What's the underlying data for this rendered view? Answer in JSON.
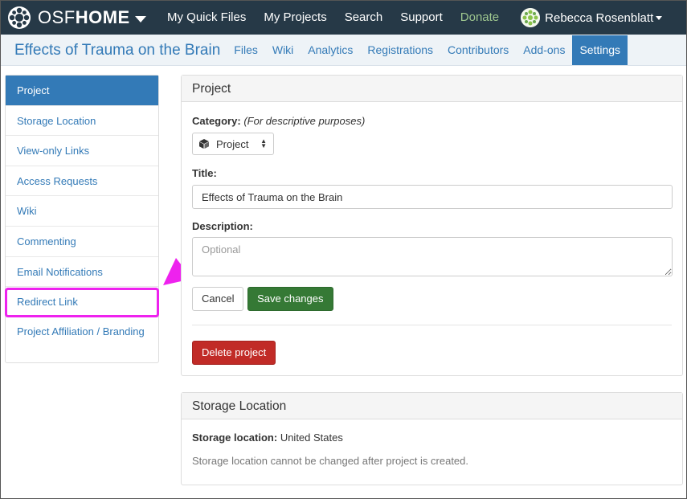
{
  "topnav": {
    "brand_osf": "OSF",
    "brand_home": "HOME",
    "links": [
      "My Quick Files",
      "My Projects",
      "Search",
      "Support"
    ],
    "donate": "Donate",
    "user_name": "Rebecca Rosenblatt"
  },
  "subnav": {
    "project_title": "Effects of Trauma on the Brain",
    "tabs": [
      "Files",
      "Wiki",
      "Analytics",
      "Registrations",
      "Contributors",
      "Add-ons",
      "Settings"
    ],
    "active_tab": "Settings"
  },
  "sidebar": {
    "items": [
      "Project",
      "Storage Location",
      "View-only Links",
      "Access Requests",
      "Wiki",
      "Commenting",
      "Email Notifications",
      "Redirect Link",
      "Project Affiliation / Branding"
    ],
    "active": "Project",
    "highlighted": "Redirect Link"
  },
  "project_panel": {
    "heading": "Project",
    "category_label": "Category:",
    "category_note": "(For descriptive purposes)",
    "category_value": "Project",
    "title_label": "Title:",
    "title_value": "Effects of Trauma on the Brain",
    "description_label": "Description:",
    "description_placeholder": "Optional",
    "cancel_label": "Cancel",
    "save_label": "Save changes",
    "delete_label": "Delete project"
  },
  "storage_panel": {
    "heading": "Storage Location",
    "location_label": "Storage location:",
    "location_value": "United States",
    "note": "Storage location cannot be changed after project is created."
  },
  "colors": {
    "nav_bg": "#263947",
    "link": "#337ab7",
    "annotation": "#ee22ee",
    "success": "#357935",
    "danger": "#c12b27",
    "donate": "#9ec78f"
  },
  "icons": {
    "logo": "osf-logo-icon",
    "brand_dropdown": "caret-down-icon",
    "category": "cube-icon",
    "annotation_arrow": "arrow-icon"
  }
}
